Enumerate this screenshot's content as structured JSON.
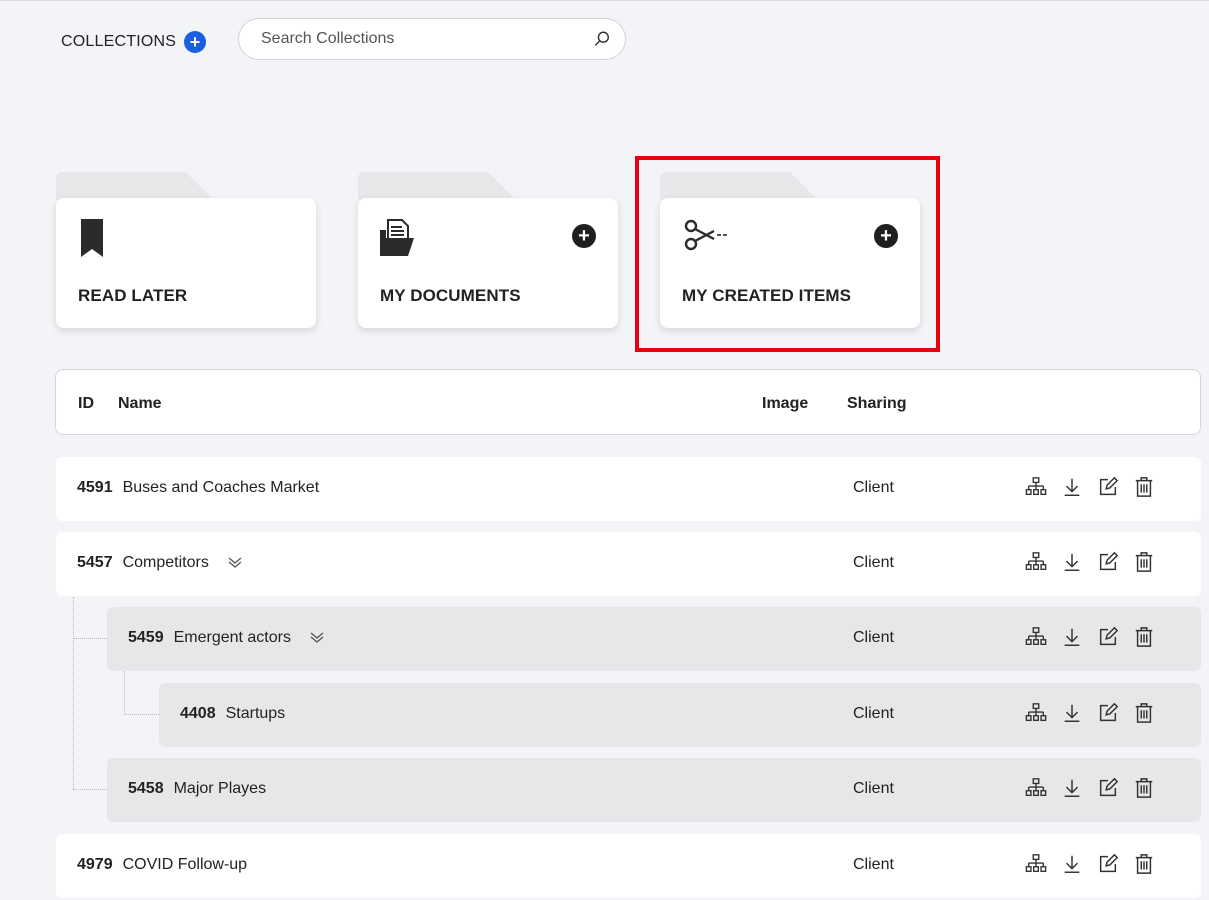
{
  "header": {
    "title": "COLLECTIONS",
    "add_icon": "plus-circle-icon",
    "search": {
      "placeholder": "Search Collections",
      "value": "",
      "icon": "search-icon"
    }
  },
  "folders": [
    {
      "label": "READ LATER",
      "icon": "bookmark-icon",
      "has_add": false
    },
    {
      "label": "MY DOCUMENTS",
      "icon": "open-folder-document-icon",
      "has_add": true
    },
    {
      "label": "MY CREATED ITEMS",
      "icon": "scissors-icon",
      "has_add": true,
      "highlighted": true
    }
  ],
  "highlight_color": "#e8000c",
  "table": {
    "columns": {
      "id": "ID",
      "name": "Name",
      "image": "Image",
      "sharing": "Sharing"
    },
    "rows": [
      {
        "id": "4591",
        "name": "Buses and Coaches Market",
        "sharing": "Client",
        "level": 0,
        "expandable": false
      },
      {
        "id": "5457",
        "name": "Competitors",
        "sharing": "Client",
        "level": 0,
        "expandable": true
      },
      {
        "id": "5459",
        "name": "Emergent actors",
        "sharing": "Client",
        "level": 1,
        "expandable": true
      },
      {
        "id": "4408",
        "name": "Startups",
        "sharing": "Client",
        "level": 2,
        "expandable": false
      },
      {
        "id": "5458",
        "name": "Major Playes",
        "sharing": "Client",
        "level": 1,
        "expandable": false
      },
      {
        "id": "4979",
        "name": "COVID Follow-up",
        "sharing": "Client",
        "level": 0,
        "expandable": false
      }
    ],
    "row_actions": [
      "hierarchy-icon",
      "download-icon",
      "edit-icon",
      "trash-icon"
    ]
  },
  "colors": {
    "accent_blue": "#1a5fe0",
    "background": "#f3f4f7",
    "nested_row": "#e7e7ea"
  }
}
